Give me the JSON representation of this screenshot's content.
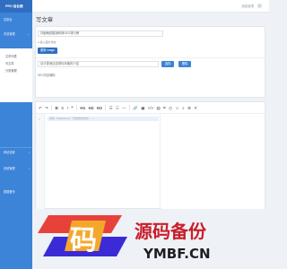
{
  "header": {
    "brand": "PRO 后台面",
    "user": "超级管理"
  },
  "sidebar": {
    "items": [
      {
        "label": "控制台"
      },
      {
        "label": "内容管理"
      },
      {
        "label": "网站设置"
      },
      {
        "label": "系统管理"
      },
      {
        "label": "数据备份"
      }
    ],
    "sub_items": [
      {
        "label": "文章列表"
      },
      {
        "label": "写文章"
      },
      {
        "label": "分类管理"
      }
    ]
  },
  "page": {
    "title": "写文章",
    "title_input_value": "详细阐述模版转换SEO排行榜",
    "upload_label": "● 输入图片地址",
    "upload_button": "图像 Image",
    "summary_placeholder": "请计算添加自带标本输的介绍",
    "btn_select": "选择",
    "btn_clear": "删除",
    "seo_text": "SEO内容辅助"
  },
  "editor": {
    "toolbar": [
      "↶",
      "↷",
      "B",
      "S",
      "I",
      "❝",
      "H1",
      "H2",
      "H3",
      "☰",
      "☷",
      "—",
      "🔗",
      "▣",
      "</>",
      "▤",
      "⌗",
      "◷",
      "☺",
      "⌕",
      "⚙",
      "✕"
    ],
    "line_number": "1",
    "placeholder": "请你（Markdown）开始你的创作……"
  },
  "watermark": {
    "cn": "源码备份",
    "en": "YMBF.CN",
    "glyph": "码"
  },
  "colors": {
    "sidebar": "#3c84d8",
    "brand": "#2f6ec0",
    "accent": "#3c84d8"
  }
}
